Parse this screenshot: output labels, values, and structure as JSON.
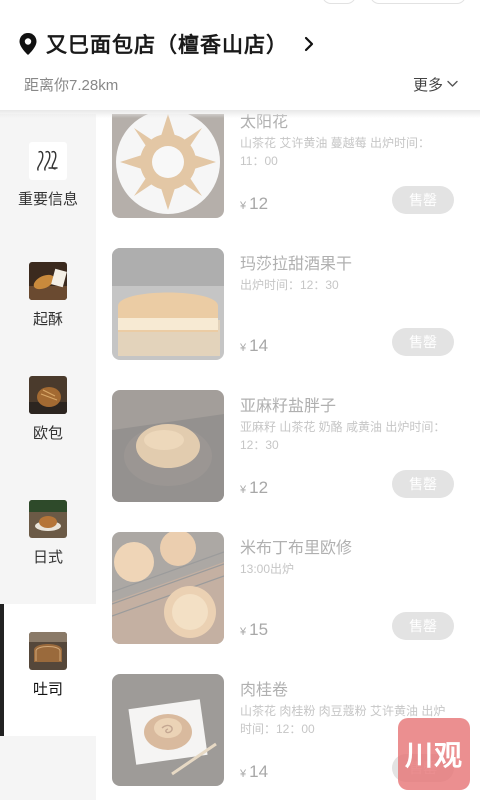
{
  "store": {
    "name": "又巳面包店（檀香山店）",
    "distance": "距离你7.28km",
    "more_label": "更多"
  },
  "sidebar": {
    "items": [
      {
        "label": "重要信息",
        "icon": "jl-logo-icon",
        "active": false
      },
      {
        "label": "起酥",
        "icon": "pastry-icon",
        "active": false
      },
      {
        "label": "欧包",
        "icon": "european-bread-icon",
        "active": false
      },
      {
        "label": "日式",
        "icon": "japanese-bread-icon",
        "active": false
      },
      {
        "label": "吐司",
        "icon": "toast-icon",
        "active": true
      }
    ]
  },
  "products": [
    {
      "name": "太阳花",
      "desc": "山茶花 艾许黄油 蔓越莓 出炉时间：11：00",
      "currency": "¥",
      "price": "12",
      "status": "售罄"
    },
    {
      "name": "玛莎拉甜酒果干",
      "desc": "出炉时间：12：30",
      "currency": "¥",
      "price": "14",
      "status": "售罄"
    },
    {
      "name": "亚麻籽盐胖子",
      "desc": "亚麻籽 山茶花 奶酪 咸黄油 出炉时间：12：30",
      "currency": "¥",
      "price": "12",
      "status": "售罄"
    },
    {
      "name": "米布丁布里欧修",
      "desc": "13:00出炉",
      "currency": "¥",
      "price": "15",
      "status": "售罄"
    },
    {
      "name": "肉桂卷",
      "desc": "山茶花 肉桂粉 肉豆蔻粉 艾许黄油 出炉时间：12：00",
      "currency": "¥",
      "price": "14",
      "status": "售罄"
    }
  ],
  "watermark": {
    "text": "川观"
  },
  "colors": {
    "sold_out_bg": "#e3e3e3",
    "sidebar_bg": "#f5f5f5",
    "watermark": "#e77678"
  }
}
